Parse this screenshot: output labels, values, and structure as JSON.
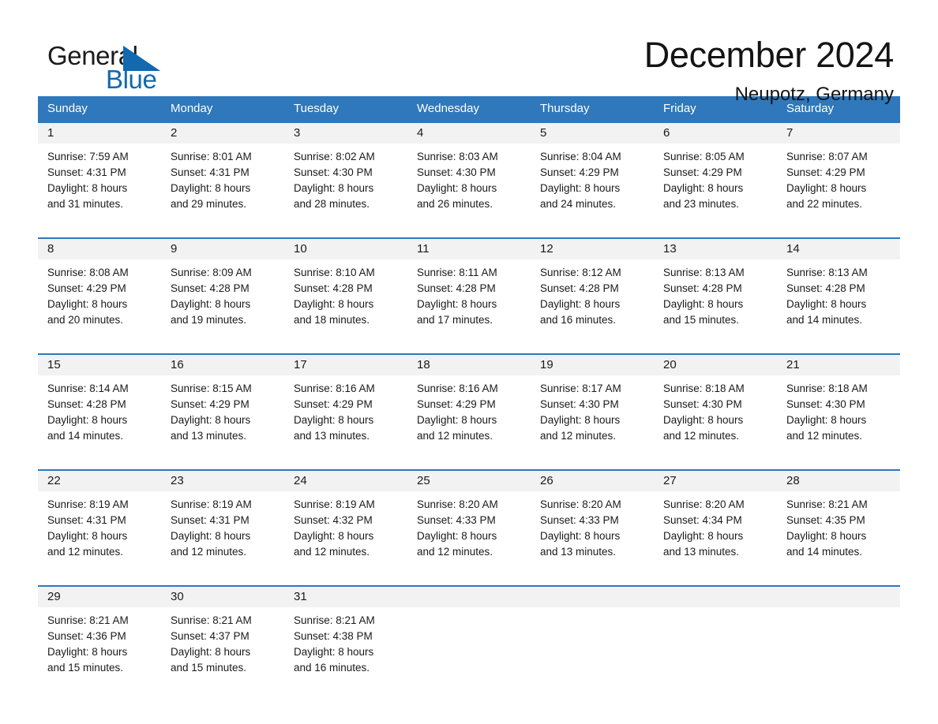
{
  "brand": {
    "name_first": "General",
    "name_second": "Blue",
    "accent_color": "#1169b0",
    "triangle_icon": "brand-triangle-icon"
  },
  "header": {
    "month_title": "December 2024",
    "location": "Neupotz, Germany"
  },
  "theme": {
    "header_bar_color": "#2f78bb",
    "day_strip_color": "#f2f2f2",
    "text_color": "#1a1a1a"
  },
  "calendar": {
    "weekday_headers": [
      "Sunday",
      "Monday",
      "Tuesday",
      "Wednesday",
      "Thursday",
      "Friday",
      "Saturday"
    ],
    "weeks": [
      [
        {
          "date": "1",
          "sunrise": "Sunrise: 7:59 AM",
          "sunset": "Sunset: 4:31 PM",
          "daylight_line1": "Daylight: 8 hours",
          "daylight_line2": "and 31 minutes."
        },
        {
          "date": "2",
          "sunrise": "Sunrise: 8:01 AM",
          "sunset": "Sunset: 4:31 PM",
          "daylight_line1": "Daylight: 8 hours",
          "daylight_line2": "and 29 minutes."
        },
        {
          "date": "3",
          "sunrise": "Sunrise: 8:02 AM",
          "sunset": "Sunset: 4:30 PM",
          "daylight_line1": "Daylight: 8 hours",
          "daylight_line2": "and 28 minutes."
        },
        {
          "date": "4",
          "sunrise": "Sunrise: 8:03 AM",
          "sunset": "Sunset: 4:30 PM",
          "daylight_line1": "Daylight: 8 hours",
          "daylight_line2": "and 26 minutes."
        },
        {
          "date": "5",
          "sunrise": "Sunrise: 8:04 AM",
          "sunset": "Sunset: 4:29 PM",
          "daylight_line1": "Daylight: 8 hours",
          "daylight_line2": "and 24 minutes."
        },
        {
          "date": "6",
          "sunrise": "Sunrise: 8:05 AM",
          "sunset": "Sunset: 4:29 PM",
          "daylight_line1": "Daylight: 8 hours",
          "daylight_line2": "and 23 minutes."
        },
        {
          "date": "7",
          "sunrise": "Sunrise: 8:07 AM",
          "sunset": "Sunset: 4:29 PM",
          "daylight_line1": "Daylight: 8 hours",
          "daylight_line2": "and 22 minutes."
        }
      ],
      [
        {
          "date": "8",
          "sunrise": "Sunrise: 8:08 AM",
          "sunset": "Sunset: 4:29 PM",
          "daylight_line1": "Daylight: 8 hours",
          "daylight_line2": "and 20 minutes."
        },
        {
          "date": "9",
          "sunrise": "Sunrise: 8:09 AM",
          "sunset": "Sunset: 4:28 PM",
          "daylight_line1": "Daylight: 8 hours",
          "daylight_line2": "and 19 minutes."
        },
        {
          "date": "10",
          "sunrise": "Sunrise: 8:10 AM",
          "sunset": "Sunset: 4:28 PM",
          "daylight_line1": "Daylight: 8 hours",
          "daylight_line2": "and 18 minutes."
        },
        {
          "date": "11",
          "sunrise": "Sunrise: 8:11 AM",
          "sunset": "Sunset: 4:28 PM",
          "daylight_line1": "Daylight: 8 hours",
          "daylight_line2": "and 17 minutes."
        },
        {
          "date": "12",
          "sunrise": "Sunrise: 8:12 AM",
          "sunset": "Sunset: 4:28 PM",
          "daylight_line1": "Daylight: 8 hours",
          "daylight_line2": "and 16 minutes."
        },
        {
          "date": "13",
          "sunrise": "Sunrise: 8:13 AM",
          "sunset": "Sunset: 4:28 PM",
          "daylight_line1": "Daylight: 8 hours",
          "daylight_line2": "and 15 minutes."
        },
        {
          "date": "14",
          "sunrise": "Sunrise: 8:13 AM",
          "sunset": "Sunset: 4:28 PM",
          "daylight_line1": "Daylight: 8 hours",
          "daylight_line2": "and 14 minutes."
        }
      ],
      [
        {
          "date": "15",
          "sunrise": "Sunrise: 8:14 AM",
          "sunset": "Sunset: 4:28 PM",
          "daylight_line1": "Daylight: 8 hours",
          "daylight_line2": "and 14 minutes."
        },
        {
          "date": "16",
          "sunrise": "Sunrise: 8:15 AM",
          "sunset": "Sunset: 4:29 PM",
          "daylight_line1": "Daylight: 8 hours",
          "daylight_line2": "and 13 minutes."
        },
        {
          "date": "17",
          "sunrise": "Sunrise: 8:16 AM",
          "sunset": "Sunset: 4:29 PM",
          "daylight_line1": "Daylight: 8 hours",
          "daylight_line2": "and 13 minutes."
        },
        {
          "date": "18",
          "sunrise": "Sunrise: 8:16 AM",
          "sunset": "Sunset: 4:29 PM",
          "daylight_line1": "Daylight: 8 hours",
          "daylight_line2": "and 12 minutes."
        },
        {
          "date": "19",
          "sunrise": "Sunrise: 8:17 AM",
          "sunset": "Sunset: 4:30 PM",
          "daylight_line1": "Daylight: 8 hours",
          "daylight_line2": "and 12 minutes."
        },
        {
          "date": "20",
          "sunrise": "Sunrise: 8:18 AM",
          "sunset": "Sunset: 4:30 PM",
          "daylight_line1": "Daylight: 8 hours",
          "daylight_line2": "and 12 minutes."
        },
        {
          "date": "21",
          "sunrise": "Sunrise: 8:18 AM",
          "sunset": "Sunset: 4:30 PM",
          "daylight_line1": "Daylight: 8 hours",
          "daylight_line2": "and 12 minutes."
        }
      ],
      [
        {
          "date": "22",
          "sunrise": "Sunrise: 8:19 AM",
          "sunset": "Sunset: 4:31 PM",
          "daylight_line1": "Daylight: 8 hours",
          "daylight_line2": "and 12 minutes."
        },
        {
          "date": "23",
          "sunrise": "Sunrise: 8:19 AM",
          "sunset": "Sunset: 4:31 PM",
          "daylight_line1": "Daylight: 8 hours",
          "daylight_line2": "and 12 minutes."
        },
        {
          "date": "24",
          "sunrise": "Sunrise: 8:19 AM",
          "sunset": "Sunset: 4:32 PM",
          "daylight_line1": "Daylight: 8 hours",
          "daylight_line2": "and 12 minutes."
        },
        {
          "date": "25",
          "sunrise": "Sunrise: 8:20 AM",
          "sunset": "Sunset: 4:33 PM",
          "daylight_line1": "Daylight: 8 hours",
          "daylight_line2": "and 12 minutes."
        },
        {
          "date": "26",
          "sunrise": "Sunrise: 8:20 AM",
          "sunset": "Sunset: 4:33 PM",
          "daylight_line1": "Daylight: 8 hours",
          "daylight_line2": "and 13 minutes."
        },
        {
          "date": "27",
          "sunrise": "Sunrise: 8:20 AM",
          "sunset": "Sunset: 4:34 PM",
          "daylight_line1": "Daylight: 8 hours",
          "daylight_line2": "and 13 minutes."
        },
        {
          "date": "28",
          "sunrise": "Sunrise: 8:21 AM",
          "sunset": "Sunset: 4:35 PM",
          "daylight_line1": "Daylight: 8 hours",
          "daylight_line2": "and 14 minutes."
        }
      ],
      [
        {
          "date": "29",
          "sunrise": "Sunrise: 8:21 AM",
          "sunset": "Sunset: 4:36 PM",
          "daylight_line1": "Daylight: 8 hours",
          "daylight_line2": "and 15 minutes."
        },
        {
          "date": "30",
          "sunrise": "Sunrise: 8:21 AM",
          "sunset": "Sunset: 4:37 PM",
          "daylight_line1": "Daylight: 8 hours",
          "daylight_line2": "and 15 minutes."
        },
        {
          "date": "31",
          "sunrise": "Sunrise: 8:21 AM",
          "sunset": "Sunset: 4:38 PM",
          "daylight_line1": "Daylight: 8 hours",
          "daylight_line2": "and 16 minutes."
        },
        {
          "date": "",
          "sunrise": "",
          "sunset": "",
          "daylight_line1": "",
          "daylight_line2": ""
        },
        {
          "date": "",
          "sunrise": "",
          "sunset": "",
          "daylight_line1": "",
          "daylight_line2": ""
        },
        {
          "date": "",
          "sunrise": "",
          "sunset": "",
          "daylight_line1": "",
          "daylight_line2": ""
        },
        {
          "date": "",
          "sunrise": "",
          "sunset": "",
          "daylight_line1": "",
          "daylight_line2": ""
        }
      ]
    ]
  }
}
